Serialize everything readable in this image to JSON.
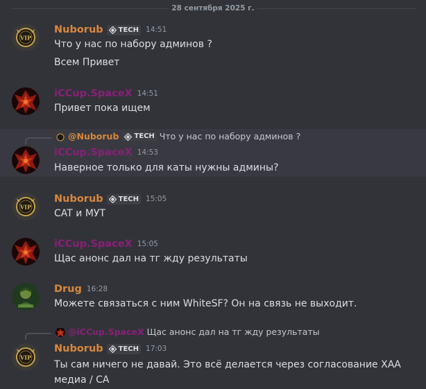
{
  "date_divider": "28 сентября 2025 г.",
  "colors": {
    "background": "#323339",
    "highlight_background": "#393a41",
    "username_orange": "#d9883b",
    "username_purple": "#8a1f79",
    "text": "#dbdee1",
    "muted": "#949ba4"
  },
  "messages": [
    {
      "author": "Nuborub",
      "tag": "TECH",
      "time": "14:51",
      "avatar": "vip-badge-avatar",
      "lines": [
        "Что у нас по набору админов ?",
        "Всем Привет"
      ]
    },
    {
      "author": "iCCup.SpaceX",
      "time": "14:51",
      "avatar": "red-dragon-avatar",
      "lines": [
        "Привет пока ищем"
      ]
    },
    {
      "reply": {
        "author": "@Nuborub",
        "tag": "TECH",
        "text": "Что у нас по набору админов ?"
      },
      "author": "iCCup.SpaceX",
      "time": "14:53",
      "avatar": "red-dragon-avatar",
      "lines": [
        "Наверное только для каты нужны админы?"
      ]
    },
    {
      "author": "Nuborub",
      "tag": "TECH",
      "time": "15:05",
      "avatar": "vip-badge-avatar",
      "lines": [
        "CAT и МУТ"
      ]
    },
    {
      "author": "iCCup.SpaceX",
      "time": "15:05",
      "avatar": "red-dragon-avatar",
      "lines": [
        "Щас анонс дал на тг жду результаты"
      ]
    },
    {
      "author": "Drug",
      "time": "16:28",
      "avatar": "green-character-avatar",
      "lines": [
        "Можете связаться с ним WhiteSF? Он на связь не выходит."
      ]
    },
    {
      "reply": {
        "author": "@iCCup.SpaceX",
        "text": "Щас анонс дал на тг жду результаты"
      },
      "author": "Nuborub",
      "tag": "TECH",
      "time": "17:03",
      "avatar": "vip-badge-avatar",
      "lines": [
        "Ты сам ничего не давай. Это всё делается через согласование ХАА медиа / СА"
      ]
    }
  ]
}
